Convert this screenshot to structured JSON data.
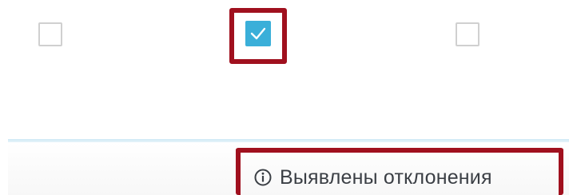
{
  "checkboxes": [
    {
      "name": "left",
      "checked": false
    },
    {
      "name": "middle",
      "checked": true
    },
    {
      "name": "right",
      "checked": false
    }
  ],
  "status": {
    "icon": "info-icon",
    "text": "Выявлены отклонения"
  },
  "colors": {
    "checkbox_checked": "#3aafd9",
    "checkbox_border": "#d0d0d0",
    "highlight": "#a0101e",
    "status_text": "#3b3f45"
  }
}
